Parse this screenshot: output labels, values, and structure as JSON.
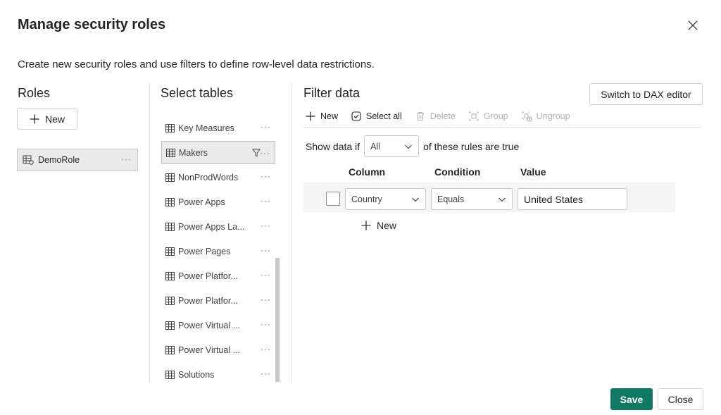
{
  "dialog": {
    "title": "Manage security roles",
    "subtitle": "Create new security roles and use filters to define row-level data restrictions."
  },
  "roles": {
    "heading": "Roles",
    "new_label": "New",
    "items": [
      {
        "label": "DemoRole"
      }
    ]
  },
  "tables": {
    "heading": "Select tables",
    "items": [
      {
        "label": "Key Measures",
        "selected": false
      },
      {
        "label": "Makers",
        "selected": true
      },
      {
        "label": "NonProdWords",
        "selected": false
      },
      {
        "label": "Power Apps",
        "selected": false
      },
      {
        "label": "Power Apps La...",
        "selected": false
      },
      {
        "label": "Power Pages",
        "selected": false
      },
      {
        "label": "Power Platfor...",
        "selected": false
      },
      {
        "label": "Power Platfor...",
        "selected": false
      },
      {
        "label": "Power Virtual ...",
        "selected": false
      },
      {
        "label": "Power Virtual ...",
        "selected": false
      },
      {
        "label": "Solutions",
        "selected": false
      }
    ]
  },
  "filter": {
    "heading": "Filter data",
    "dax_button": "Switch to DAX editor",
    "toolbar": {
      "new": "New",
      "select_all": "Select all",
      "delete": "Delete",
      "group": "Group",
      "ungroup": "Ungroup"
    },
    "show_prefix": "Show data if",
    "match_value": "All",
    "show_suffix": "of these rules are true",
    "columns": {
      "column": "Column",
      "condition": "Condition",
      "value": "Value"
    },
    "rule": {
      "column": "Country",
      "condition": "Equals",
      "value": "United States"
    },
    "new_rule_label": "New"
  },
  "footer": {
    "save": "Save",
    "close": "Close"
  },
  "colors": {
    "primary": "#117865",
    "selected_bg": "#ebebeb",
    "disabled": "#b0b0b0"
  },
  "icons": [
    "close-icon",
    "plus-icon",
    "role-icon",
    "table-icon",
    "filter-icon",
    "more-icon",
    "select-all-icon",
    "delete-icon",
    "group-icon",
    "ungroup-icon",
    "chevron-down-icon"
  ]
}
